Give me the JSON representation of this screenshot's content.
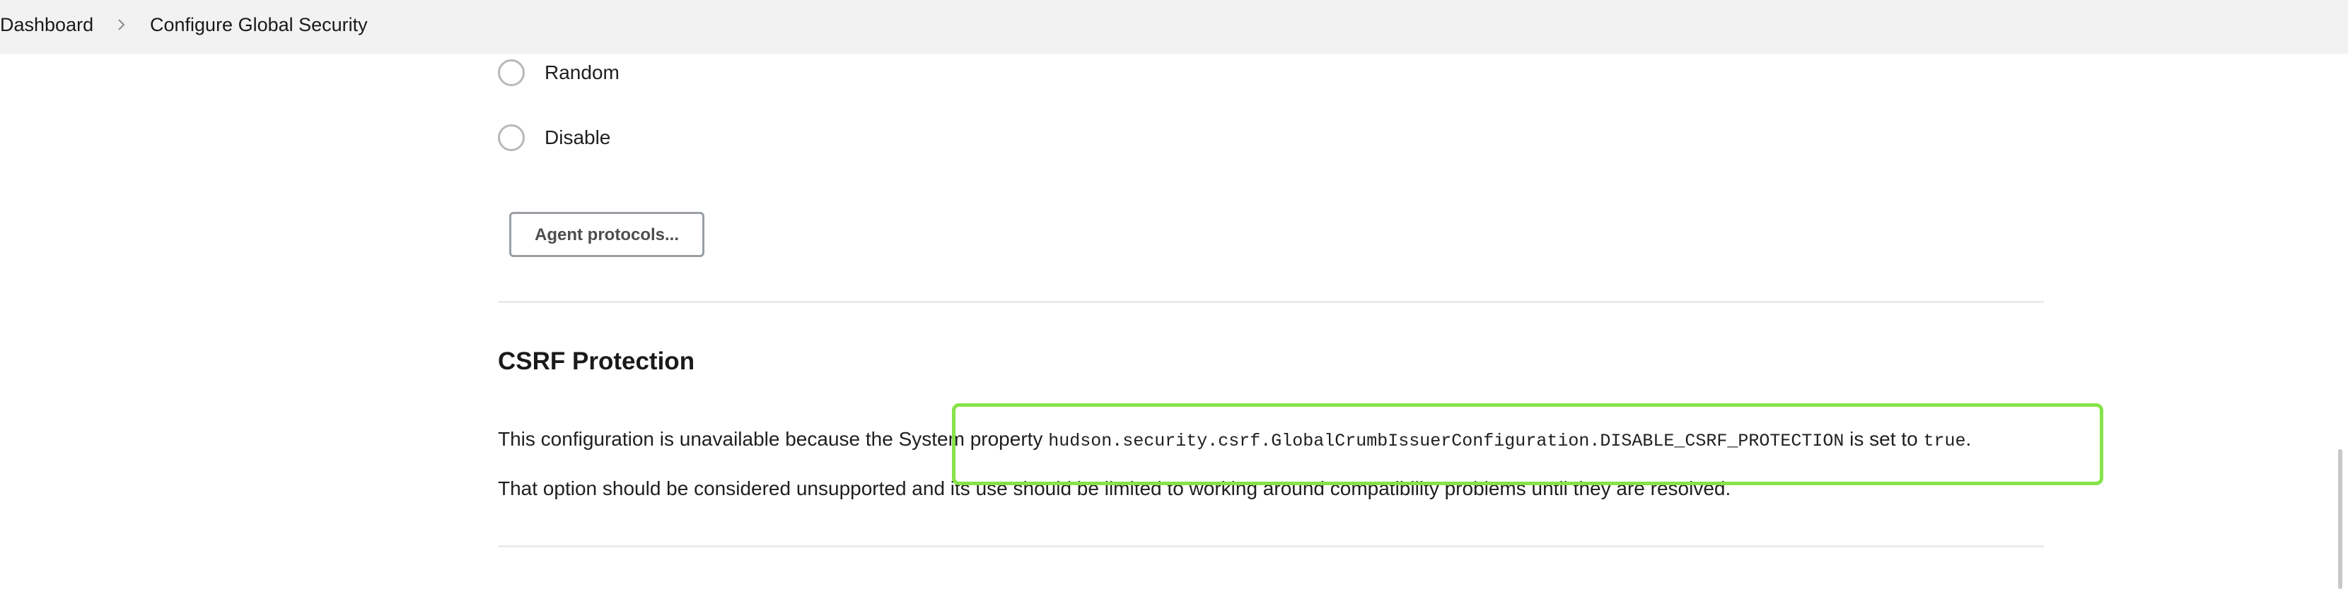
{
  "breadcrumb": {
    "items": [
      "Dashboard",
      "Configure Global Security"
    ],
    "separator_icon": "chevron-right-icon"
  },
  "agent_port": {
    "options": [
      {
        "label": "Random",
        "selected": false
      },
      {
        "label": "Disable",
        "selected": false
      }
    ],
    "agent_protocols_label": "Agent protocols..."
  },
  "csrf": {
    "title": "CSRF Protection",
    "line1_prefix": "This configuration is unavailable because the System property ",
    "property_name": "hudson.security.csrf.GlobalCrumbIssuerConfiguration.DISABLE_CSRF_PROTECTION",
    "line1_middle": " is set to ",
    "property_value": "true",
    "line1_suffix": ".",
    "line2": "That option should be considered unsupported and its use should be limited to working around compatibility problems until they are resolved."
  },
  "colors": {
    "highlight": "#86e34a",
    "breadcrumb_bg": "#f2f2f2"
  }
}
